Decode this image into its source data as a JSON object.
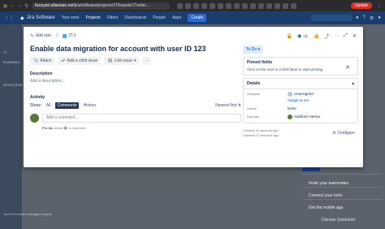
{
  "browser": {
    "url_host": "fuzzysid.atlassian.net",
    "url_path": "/jira/software/projects/JT/boards/1?selec...",
    "update_label": "Update"
  },
  "jira_nav": {
    "logo": "Jira Software",
    "items": [
      "Your work",
      "Projects",
      "Filters",
      "Dashboards",
      "People",
      "Apps"
    ],
    "create_label": "Create"
  },
  "background": {
    "right_items": [
      "Invite your teammates",
      "Connect your tools",
      "Get the mobile app"
    ],
    "dismiss_label": "Dismiss Quickstart",
    "team_managed": "You're in a team-managed project",
    "sidebar_texts": [
      "JT",
      "PLANNING",
      "DEVELOPMENT"
    ]
  },
  "modal": {
    "add_epic": "Add epic",
    "issue_key": "JT-1",
    "title": "Enable data migration for account with user ID 123",
    "buttons": [
      "Attach",
      "Add a child issue",
      "Link issue"
    ],
    "description_label": "Description",
    "description_placeholder": "Add a description...",
    "activity_label": "Activity",
    "show_label": "Show:",
    "tabs": [
      "All",
      "Comments",
      "History"
    ],
    "sort_label": "Newest first",
    "comment_placeholder": "Add a comment...",
    "protip_prefix": "Pro tip:",
    "protip_text": "press",
    "protip_key": "M",
    "protip_suffix": "to comment",
    "watch_count": "1",
    "status": "To Do",
    "pinned_title": "Pinned fields",
    "pinned_text": "Click on the   next to a field label to start pinning.",
    "details_label": "Details",
    "fields": {
      "assignee_label": "Assignee",
      "assignee_value": "Unassigned",
      "assign_to_me": "Assign to me",
      "labels_label": "Labels",
      "labels_value": "None",
      "reporter_label": "Reporter",
      "reporter_value": "Siddhant Varma"
    },
    "created": "Created 42 seconds ago",
    "updated": "Updated 42 seconds ago",
    "configure_label": "Configure"
  },
  "colors": {
    "brand_blue": "#0052cc",
    "status_bg": "#deebff",
    "update_red": "#d8302f"
  }
}
